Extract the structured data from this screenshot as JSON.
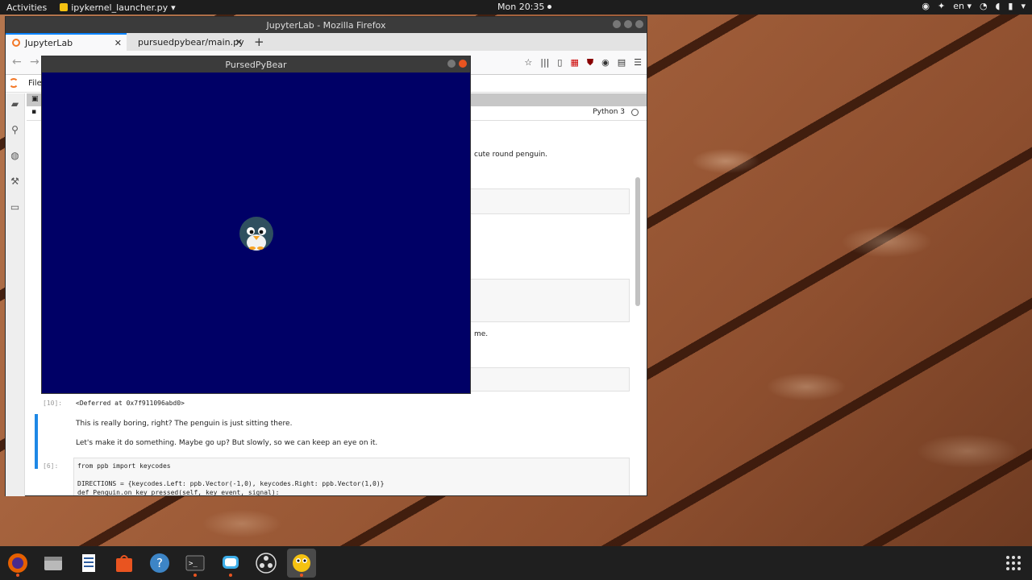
{
  "topbar": {
    "activities": "Activities",
    "app_name": "ipykernel_launcher.py",
    "clock": "Mon 20:35",
    "lang": "en"
  },
  "firefox": {
    "title": "JupyterLab - Mozilla Firefox",
    "tabs": [
      {
        "label": "JupyterLab",
        "active": true
      },
      {
        "label": "pursuedpybear/main.py",
        "active": false
      }
    ],
    "menu_file": "File",
    "kernel_name": "Python 3"
  },
  "notebook": {
    "md1_fragment": "cute round penguin.",
    "md2_fragment": "me.",
    "out10_prompt": "[10]:",
    "out10_text": "<Deferred at 0x7f911096abd0>",
    "md3_line1": "This is really boring, right? The penguin is just sitting there.",
    "md3_line2": "Let's make it do something. Maybe go up? But slowly, so we can keep an eye on it.",
    "in6_prompt": "[6]:",
    "code_line1": "from ppb import keycodes",
    "code_line2": "DIRECTIONS = {keycodes.Left: ppb.Vector(-1,0), keycodes.Right: ppb.Vector(1,0)}",
    "code_line3": "def Penguin.on_key_pressed(self, key_event, signal):"
  },
  "ppb_window": {
    "title": "PursedPyBear",
    "bg_color": "#000066"
  },
  "dock": {
    "items": [
      "firefox-icon",
      "files-icon",
      "text-editor-icon",
      "software-icon",
      "help-icon",
      "terminal-icon",
      "chat-icon",
      "obs-icon",
      "python-icon"
    ]
  }
}
